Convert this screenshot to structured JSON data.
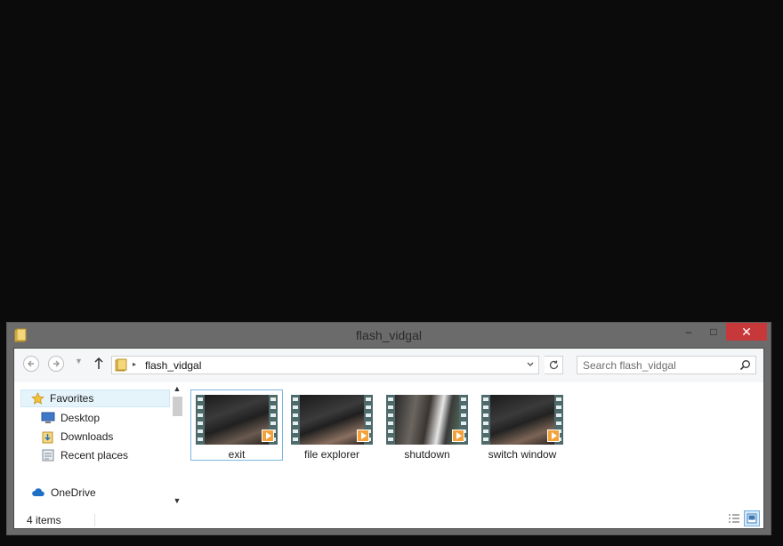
{
  "window": {
    "title": "flash_vidgal"
  },
  "titlebar": {
    "minimize": "–",
    "maximize": "□",
    "close": "✕"
  },
  "address": {
    "crumb": "flash_vidgal",
    "separator": "▸"
  },
  "search": {
    "placeholder": "Search flash_vidgal"
  },
  "navpane": {
    "favorites": "Favorites",
    "items": [
      {
        "label": "Desktop",
        "icon": "desktop-icon"
      },
      {
        "label": "Downloads",
        "icon": "downloads-folder-icon"
      },
      {
        "label": "Recent places",
        "icon": "recent-places-icon"
      }
    ],
    "onedrive": "OneDrive"
  },
  "files": [
    {
      "name": "exit",
      "selected": true
    },
    {
      "name": "file explorer",
      "selected": false
    },
    {
      "name": "shutdown",
      "selected": false
    },
    {
      "name": "switch window",
      "selected": false
    }
  ],
  "status": {
    "item_count": "4 items"
  },
  "colors": {
    "title_bar": "#6b6b6b",
    "close_button": "#c7383b",
    "selection_border": "#7ab7e3",
    "play_badge": "#f3a23a"
  }
}
